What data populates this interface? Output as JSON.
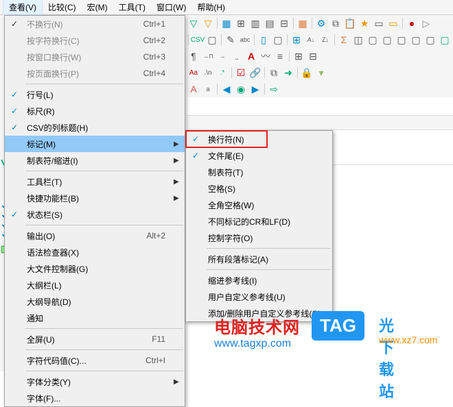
{
  "menubar": {
    "view": "查看(V)",
    "compare": "比较(C)",
    "macro": "宏(M)",
    "tools": "工具(T)",
    "window": "窗口(W)",
    "help": "帮助(H)"
  },
  "menu1": {
    "no_wrap": "不换行(N)",
    "no_wrap_sc": "Ctrl+1",
    "char_wrap": "按字符换行(C)",
    "char_wrap_sc": "Ctrl+2",
    "win_wrap": "按窗口换行(W)",
    "win_wrap_sc": "Ctrl+3",
    "page_wrap": "按页面换行(P)",
    "page_wrap_sc": "Ctrl+4",
    "line_num": "行号(L)",
    "ruler": "标尺(R)",
    "csv_header": "CSV的列标题(H)",
    "marks": "标记(M)",
    "tabs_indent": "制表符/缩进(I)",
    "toolbar": "工具栏(T)",
    "quickbar": "快捷功能栏(B)",
    "statusbar": "状态栏(S)",
    "output": "输出(O)",
    "output_sc": "Alt+2",
    "syntax": "语法检查器(X)",
    "largefile": "大文件控制器(G)",
    "outline": "大纲栏(L)",
    "outlinenav": "大纲导航(D)",
    "notify": "通知",
    "fullscreen": "全屏(U)",
    "fullscreen_sc": "F11",
    "charcode": "字符代码值(C)...",
    "charcode_sc": "Ctrl+I",
    "font_cat": "字体分类(Y)",
    "font": "字体(F)..."
  },
  "menu2": {
    "newline": "换行符(N)",
    "eof": "文件尾(E)",
    "tab": "制表符(T)",
    "space": "空格(S)",
    "fullspace": "全角空格(W)",
    "crlf": "不同标记的CR和LF(D)",
    "ctrlchar": "控制字符(O)",
    "all_para": "所有段落标记(A)",
    "indent_guide": "缩进参考线(I)",
    "user_guide": "用户自定义参考线(U)",
    "add_guide": "添加/删除用户自定义参考线(G)"
  },
  "watermark": {
    "line1": "电脑技术网",
    "line2": "www.tagxp.com",
    "tag": "TAG",
    "side": "光下载站",
    "side2": "www.xz7.com"
  }
}
